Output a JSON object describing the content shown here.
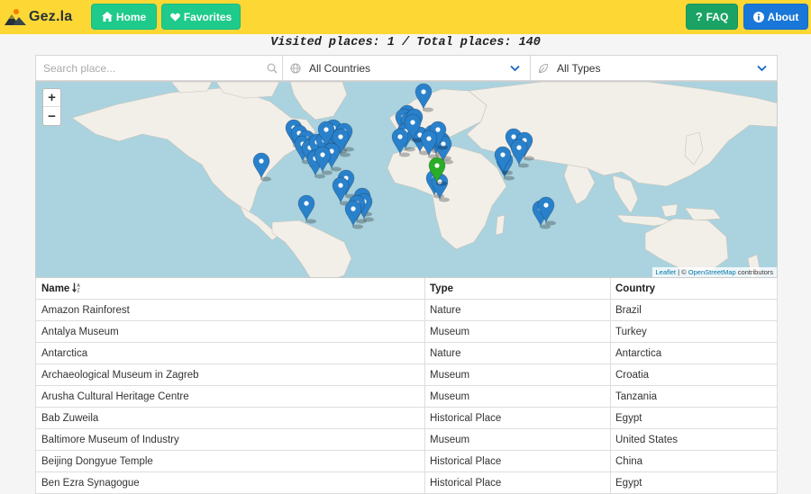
{
  "navbar": {
    "brand": "Gez.la",
    "home_label": "Home",
    "favorites_label": "Favorites",
    "faq_label": "FAQ",
    "about_label": "About",
    "icons": {
      "home": "home-icon",
      "favorites": "heart-icon",
      "faq": "question-icon",
      "about": "info-icon"
    },
    "colors": {
      "bar": "#fdd835",
      "home": "#1fcb8b",
      "favorites": "#1aa364",
      "faq": "#1aa364",
      "about": "#1877d9"
    }
  },
  "stats": {
    "text": "Visited places: 1 / Total places: 140"
  },
  "filters": {
    "search_placeholder": "Search place...",
    "country_value": "All Countries",
    "type_value": "All Types"
  },
  "map": {
    "zoom_in": "+",
    "zoom_out": "−",
    "attribution_leaflet": "Leaflet",
    "attribution_sep": " | © ",
    "attribution_osm": "OpenStreetMap",
    "attribution_tail": " contributors",
    "marker_colors": {
      "default": "#2a81cb",
      "visited": "#2aad27"
    }
  },
  "table": {
    "headers": {
      "name": "Name",
      "type": "Type",
      "country": "Country"
    },
    "rows": [
      {
        "name": "Amazon Rainforest",
        "type": "Nature",
        "country": "Brazil"
      },
      {
        "name": "Antalya Museum",
        "type": "Museum",
        "country": "Turkey"
      },
      {
        "name": "Antarctica",
        "type": "Nature",
        "country": "Antarctica"
      },
      {
        "name": "Archaeological Museum in Zagreb",
        "type": "Museum",
        "country": "Croatia"
      },
      {
        "name": "Arusha Cultural Heritage Centre",
        "type": "Museum",
        "country": "Tanzania"
      },
      {
        "name": "Bab Zuweila",
        "type": "Historical Place",
        "country": "Egypt"
      },
      {
        "name": "Baltimore Museum of Industry",
        "type": "Museum",
        "country": "United States"
      },
      {
        "name": "Beijing Dongyue Temple",
        "type": "Historical Place",
        "country": "China"
      },
      {
        "name": "Ben Ezra Synagogue",
        "type": "Historical Place",
        "country": "Egypt"
      }
    ]
  }
}
